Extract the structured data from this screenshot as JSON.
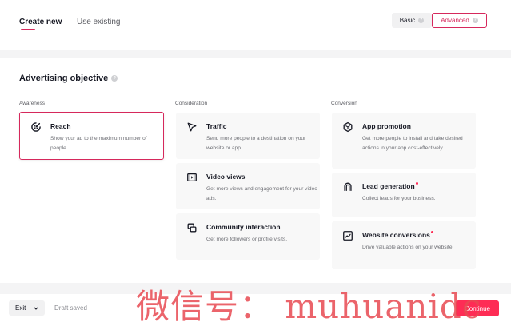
{
  "tabs": [
    {
      "label": "Create new",
      "active": true
    },
    {
      "label": "Use existing",
      "active": false
    }
  ],
  "mode": {
    "basic_label": "Basic",
    "advanced_label": "Advanced",
    "selected": "Advanced"
  },
  "section": {
    "title": "Advertising objective"
  },
  "columns": [
    {
      "heading": "Awareness",
      "cards": [
        {
          "title": "Reach",
          "description": "Show your ad to the maximum number of people.",
          "icon": "reach-target-icon",
          "selected": true
        }
      ]
    },
    {
      "heading": "Consideration",
      "cards": [
        {
          "title": "Traffic",
          "description": "Send more people to a destination on your website or app.",
          "icon": "cursor-arrow-icon"
        },
        {
          "title": "Video views",
          "description": "Get more views and engagement for your video ads.",
          "icon": "film-icon"
        },
        {
          "title": "Community interaction",
          "description": "Get more followers or profile visits.",
          "icon": "community-icon"
        }
      ]
    },
    {
      "heading": "Conversion",
      "cards": [
        {
          "title": "App promotion",
          "description": "Get more people to install and take desired actions in your app cost-effectively.",
          "icon": "app-hexagon-icon"
        },
        {
          "title": "Lead generation",
          "description": "Collect leads for your business.",
          "icon": "lead-magnet-icon",
          "required_dot": true
        },
        {
          "title": "Website conversions",
          "description": "Drive valuable actions on your website.",
          "icon": "trend-chart-icon",
          "required_dot": true
        }
      ]
    }
  ],
  "footer": {
    "exit_label": "Exit",
    "draft_status": "Draft saved",
    "continue_label": "Continue"
  },
  "watermark": "微信号： muhuanidc",
  "colors": {
    "accent": "#d6285c",
    "primary_button": "#fe2c55",
    "card_bg": "#f8f8f8",
    "band_bg": "#f4f4f5"
  }
}
